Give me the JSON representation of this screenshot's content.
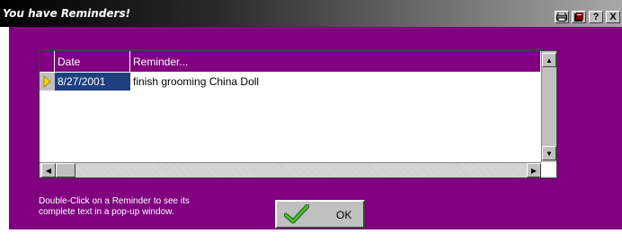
{
  "window": {
    "title": "You have Reminders!"
  },
  "titlebar": {
    "help_label": "?",
    "close_label": "X"
  },
  "grid": {
    "columns": [
      "Date",
      "Reminder..."
    ],
    "rows": [
      {
        "date": "8/27/2001",
        "reminder": "finish grooming China Doll"
      }
    ]
  },
  "footer": {
    "help_line1": "Double-Click on a Reminder to see its",
    "help_line2": "complete text in a pop-up window.",
    "ok_label": "OK"
  },
  "icons": {
    "titlebar_btn1": "print-icon",
    "titlebar_btn2": "notes-icon",
    "ok": "checkmark-icon"
  },
  "colors": {
    "client_bg": "#800080",
    "row_selected_bg": "#1f3f7f",
    "row_indicator": "#ffd700"
  }
}
